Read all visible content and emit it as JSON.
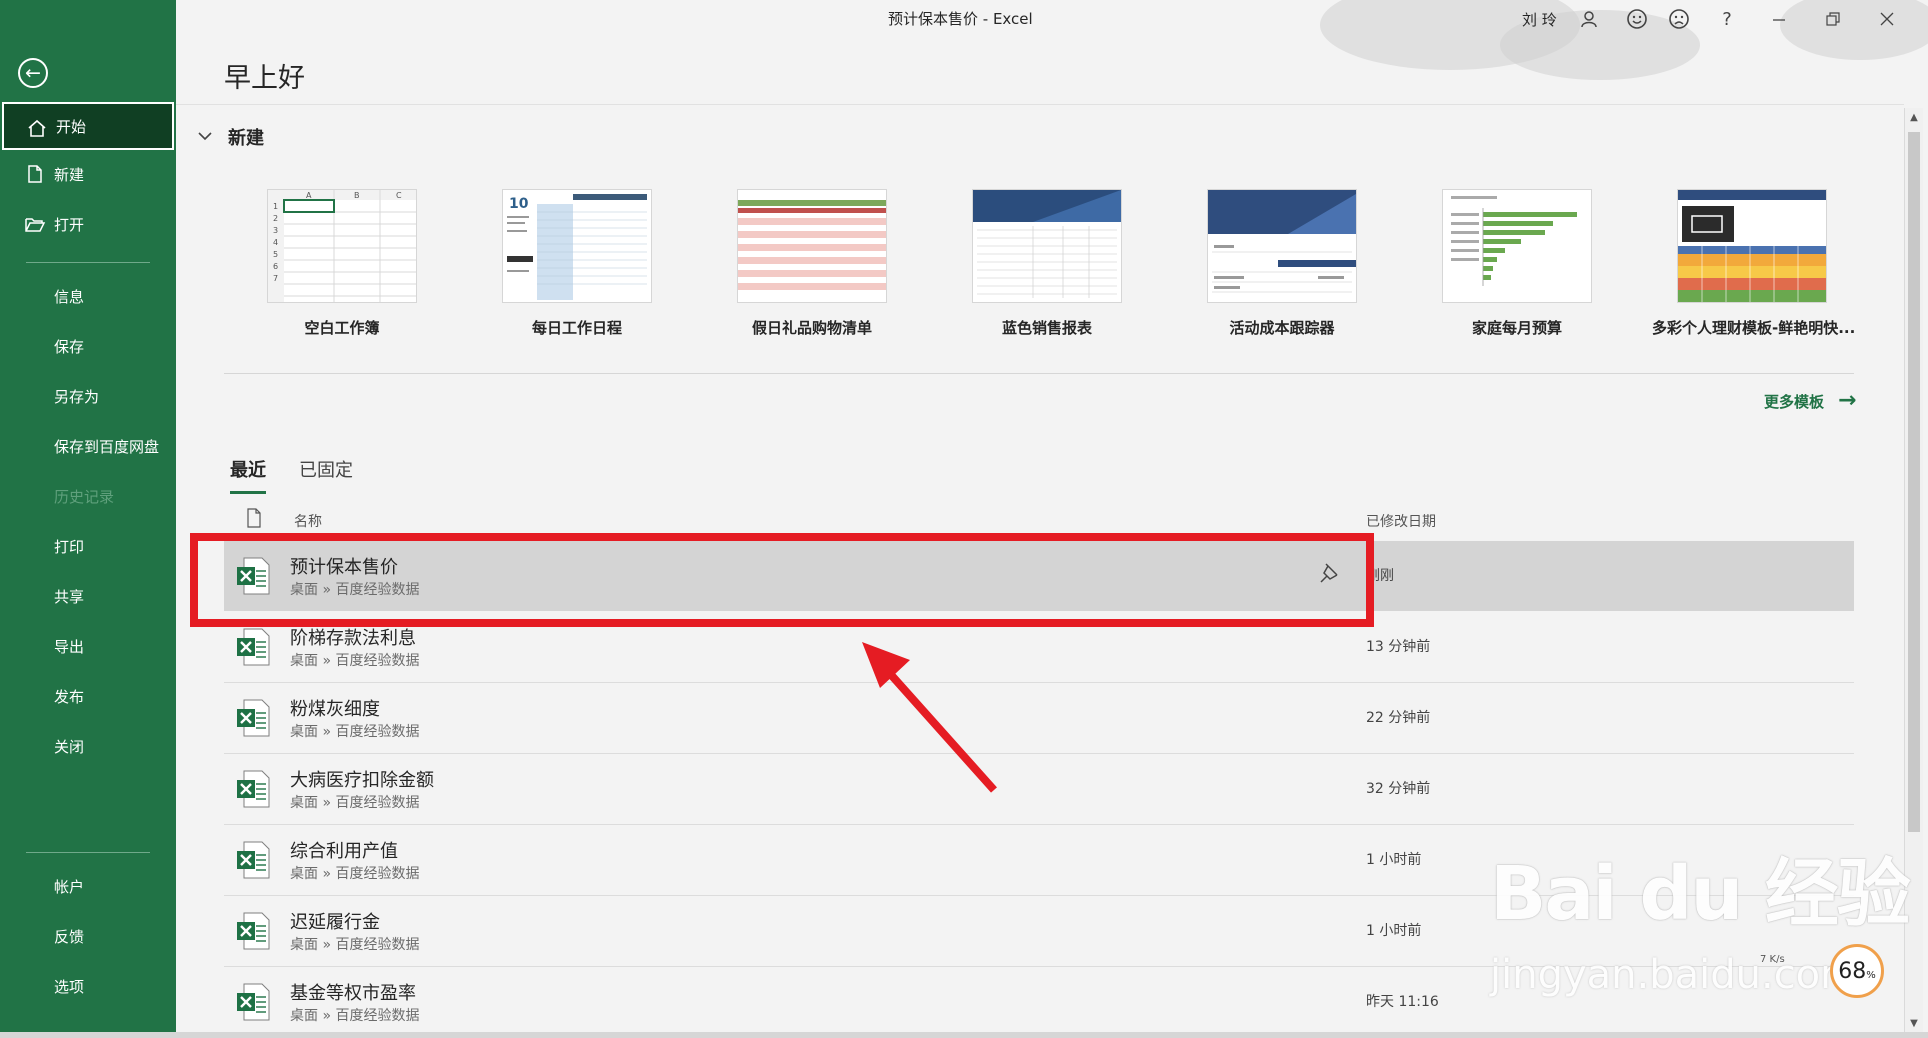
{
  "window": {
    "title": "预计保本售价 - Excel",
    "user_name": "刘 玲",
    "controls": [
      "user-icon",
      "smile-icon",
      "frown-icon",
      "help-icon",
      "minimize-icon",
      "restore-icon",
      "close-icon"
    ],
    "help_glyph": "?"
  },
  "sidebar": {
    "items": [
      {
        "label": "开始",
        "icon": "home-icon",
        "active": true
      },
      {
        "label": "新建",
        "icon": "new-file-icon"
      },
      {
        "label": "打开",
        "icon": "open-folder-icon"
      },
      {
        "label": "信息"
      },
      {
        "label": "保存"
      },
      {
        "label": "另存为"
      },
      {
        "label": "保存到百度网盘"
      },
      {
        "label": "历史记录",
        "disabled": true
      },
      {
        "label": "打印"
      },
      {
        "label": "共享"
      },
      {
        "label": "导出"
      },
      {
        "label": "发布"
      },
      {
        "label": "关闭"
      },
      {
        "label": "帐户"
      },
      {
        "label": "反馈"
      },
      {
        "label": "选项"
      }
    ]
  },
  "main": {
    "greeting": "早上好",
    "new_section": {
      "title": "新建",
      "templates": [
        {
          "name": "空白工作簿"
        },
        {
          "name": "每日工作日程",
          "thumb_number": "10"
        },
        {
          "name": "假日礼品购物清单"
        },
        {
          "name": "蓝色销售报表"
        },
        {
          "name": "活动成本跟踪器"
        },
        {
          "name": "家庭每月预算"
        },
        {
          "name": "多彩个人理财模板-鲜艳明快..."
        }
      ],
      "more_templates": "更多模板"
    },
    "tabs": [
      {
        "label": "最近",
        "active": true
      },
      {
        "label": "已固定"
      }
    ],
    "columns": {
      "name": "名称",
      "modified": "已修改日期"
    },
    "files": [
      {
        "name": "预计保本售价",
        "path": "桌面 » 百度经验数据",
        "modified": "刚刚",
        "selected": true
      },
      {
        "name": "阶梯存款法利息",
        "path": "桌面 » 百度经验数据",
        "modified": "13 分钟前"
      },
      {
        "name": "粉煤灰细度",
        "path": "桌面 » 百度经验数据",
        "modified": "22 分钟前"
      },
      {
        "name": "大病医疗扣除金额",
        "path": "桌面 » 百度经验数据",
        "modified": "32 分钟前"
      },
      {
        "name": "综合利用产值",
        "path": "桌面 » 百度经验数据",
        "modified": "1 小时前"
      },
      {
        "name": "迟延履行金",
        "path": "桌面 » 百度经验数据",
        "modified": "1 小时前"
      },
      {
        "name": "基金等权市盈率",
        "path": "桌面 » 百度经验数据",
        "modified": "昨天 11:16"
      }
    ]
  },
  "overlay": {
    "watermark_logo": "Bai du 经验",
    "watermark_url": "jingyan.baidu.com",
    "speed_value": "68",
    "speed_unit": "%",
    "speed_rate": "7 K/s",
    "accent_color": "#217346",
    "highlight_color": "#e51c23"
  }
}
